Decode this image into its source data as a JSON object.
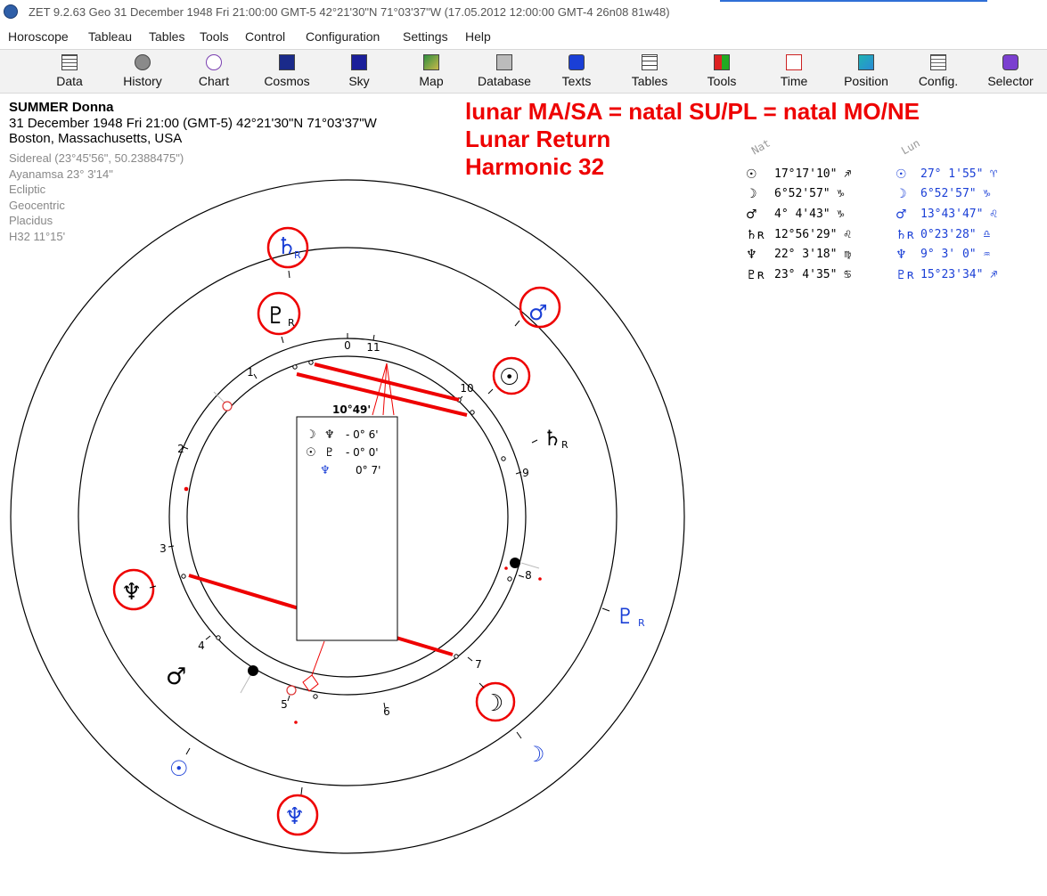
{
  "window": {
    "title": "ZET 9.2.63 Geo   31 December 1948  Fri  21:00:00 GMT-5 42°21'30\"N  71°03'37\"W  (17.05.2012  12:00:00 GMT-4 26n08 81w48)"
  },
  "menu": [
    "Horoscope",
    "Tableau",
    "Tables",
    "Tools",
    "Control",
    "Configuration",
    "Settings",
    "Help"
  ],
  "toolbar": [
    {
      "label": "Data",
      "icon": "data-grid-icon"
    },
    {
      "label": "History",
      "icon": "history-icon"
    },
    {
      "label": "Chart",
      "icon": "chart-wheel-icon"
    },
    {
      "label": "Cosmos",
      "icon": "cosmos-icon"
    },
    {
      "label": "Sky",
      "icon": "sky-icon"
    },
    {
      "label": "Map",
      "icon": "map-icon"
    },
    {
      "label": "Database",
      "icon": "database-icon"
    },
    {
      "label": "Texts",
      "icon": "texts-icon"
    },
    {
      "label": "Tables",
      "icon": "tables-icon"
    },
    {
      "label": "Tools",
      "icon": "tools-icon"
    },
    {
      "label": "Time",
      "icon": "time-icon"
    },
    {
      "label": "Position",
      "icon": "position-icon"
    },
    {
      "label": "Config.",
      "icon": "config-icon"
    },
    {
      "label": "Selector",
      "icon": "selector-icon"
    }
  ],
  "info": {
    "name": "SUMMER Donna",
    "date_line": "31 December 1948  Fri  21:00 (GMT-5) 42°21'30\"N  71°03'37\"W",
    "place": "Boston, Massachusetts, USA",
    "sidereal": "Sidereal (23°45'56\", 50.2388475\")",
    "ayanamsa": "Ayanamsa 23° 3'14\"",
    "ecliptic": "Ecliptic",
    "geocentric": "Geocentric",
    "houses": "Placidus",
    "harmonic": "H32  11°15'"
  },
  "annotation": {
    "line1": "lunar MA/SA = natal SU/PL = natal MO/NE",
    "line2": "Lunar Return",
    "line3": "Harmonic 32"
  },
  "positions": {
    "nat_header": "Nat",
    "lun_header": "Lun",
    "rows": [
      {
        "nat_glyph": "☉",
        "nat_val": "17°17'10\" ♐",
        "lun_glyph": "☉",
        "lun_val": "27° 1'55\" ♈"
      },
      {
        "nat_glyph": "☽",
        "nat_val": " 6°52'57\" ♑",
        "lun_glyph": "☽",
        "lun_val": " 6°52'57\" ♑"
      },
      {
        "nat_glyph": "♂",
        "nat_val": " 4° 4'43\" ♑",
        "lun_glyph": "♂",
        "lun_val": "13°43'47\" ♌"
      },
      {
        "nat_glyph": "♄ʀ",
        "nat_val": "12°56'29\" ♌",
        "lun_glyph": "♄ʀ",
        "lun_val": " 0°23'28\" ♎"
      },
      {
        "nat_glyph": "♆",
        "nat_val": "22° 3'18\" ♍",
        "lun_glyph": "♆",
        "lun_val": " 9° 3' 0\" ♒"
      },
      {
        "nat_glyph": "♇ʀ",
        "nat_val": "23° 4'35\" ♋",
        "lun_glyph": "♇ʀ",
        "lun_val": "15°23'34\" ♐"
      }
    ]
  },
  "chart": {
    "house_numbers": [
      "0",
      "11",
      "10",
      "9",
      "8",
      "7",
      "6",
      "5",
      "4",
      "3",
      "2",
      "1"
    ],
    "angle_label": "10°49'",
    "aspect_box": {
      "row1": {
        "a": "☽",
        "b": "♆",
        "val": "- 0° 6'"
      },
      "row2": {
        "a": "☉",
        "b": "♇",
        "val": "- 0° 0'"
      },
      "row3": {
        "a": "♆",
        "val": "0° 7'"
      }
    },
    "outer_planets": {
      "saturn": "♄",
      "saturn_r": "R",
      "mars": "♂",
      "pluto": "♇",
      "pluto_r": "R",
      "moon": "☽",
      "sun": "☉",
      "neptune": "♆"
    },
    "middle_planets": {
      "pluto": "♇",
      "pluto_r": "R",
      "sun": "☉",
      "saturn": "♄",
      "saturn_r": "R",
      "neptune": "♆",
      "mars": "♂",
      "moon": "☽"
    },
    "colors": {
      "natal": "#000000",
      "lunar": "#1a3fd6",
      "highlight": "#ee0000"
    }
  }
}
